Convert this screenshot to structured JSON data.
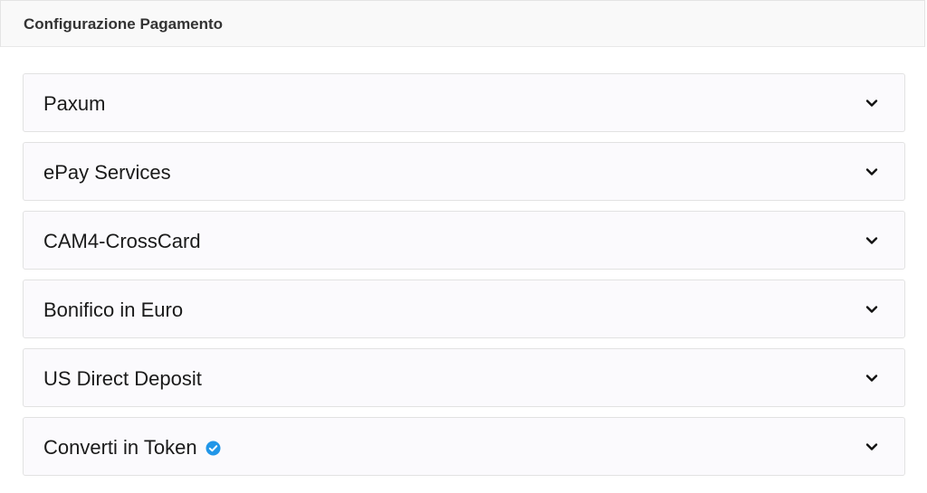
{
  "header": {
    "title": "Configurazione Pagamento"
  },
  "payment_methods": [
    {
      "label": "Paxum",
      "verified": false,
      "expanded": false
    },
    {
      "label": "ePay Services",
      "verified": false,
      "expanded": false
    },
    {
      "label": "CAM4-CrossCard",
      "verified": false,
      "expanded": false
    },
    {
      "label": "Bonifico in Euro",
      "verified": false,
      "expanded": false
    },
    {
      "label": "US Direct Deposit",
      "verified": false,
      "expanded": false
    },
    {
      "label": "Converti in Token",
      "verified": true,
      "expanded": false
    }
  ],
  "icons": {
    "expand": "chevron-down-icon",
    "verified": "verified-check-icon"
  },
  "colors": {
    "verified_badge": "#2196e8",
    "chevron": "#111111"
  }
}
